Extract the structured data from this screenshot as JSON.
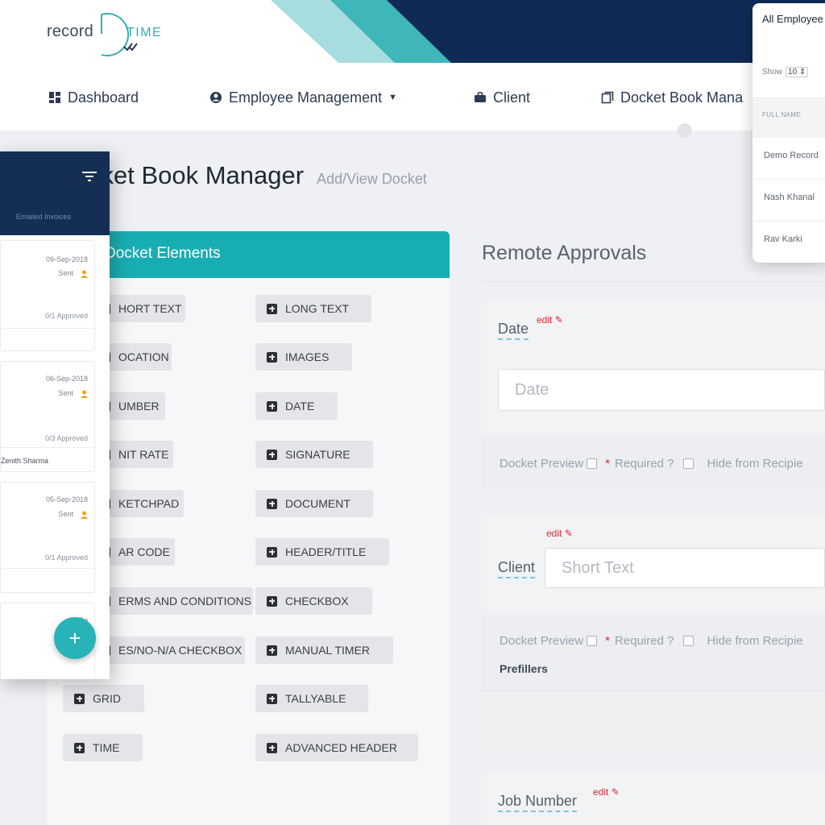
{
  "logo": {
    "word1": "record",
    "word2": "TIME"
  },
  "nav": {
    "items": [
      {
        "label": "Dashboard"
      },
      {
        "label": "Employee Management"
      },
      {
        "label": "Client"
      },
      {
        "label": "Docket Book Mana"
      }
    ]
  },
  "page": {
    "title": "cket Book Manager",
    "subtitle": "Add/View Docket"
  },
  "elements": {
    "header": "Docket Elements",
    "left": [
      "HORT TEXT",
      "OCATION",
      "UMBER",
      "NIT RATE",
      "KETCHPAD",
      "AR CODE",
      "ERMS AND CONDITIONS",
      "ES/NO-N/A CHECKBOX",
      "GRID",
      "TIME"
    ],
    "right": [
      "LONG TEXT",
      "IMAGES",
      "DATE",
      "SIGNATURE",
      "DOCUMENT",
      "HEADER/TITLE",
      "CHECKBOX",
      "MANUAL TIMER",
      "TALLYABLE",
      "ADVANCED HEADER"
    ]
  },
  "remote": {
    "title": "Remote Approvals",
    "edit": "edit",
    "date": {
      "label": "Date",
      "placeholder": "Date"
    },
    "options": {
      "preview": "Docket Preview",
      "required": "Required ?",
      "hide": "Hide from Recipie"
    },
    "client": {
      "label": "Client",
      "placeholder": "Short Text",
      "prefillers": "Prefillers"
    },
    "job": {
      "label": "Job Number"
    }
  },
  "mobile": {
    "tab": "Emailed Invoices",
    "cards": [
      {
        "date": "09-Sep-2018",
        "status": "Sent",
        "approved": "0/1 Approved",
        "name": ""
      },
      {
        "date": "06-Sep-2018",
        "status": "Sent",
        "approved": "0/3 Approved",
        "name": "Zenith Sharma"
      },
      {
        "date": "05-Sep-2018",
        "status": "Sent",
        "approved": "0/1 Approved",
        "name": ""
      },
      {
        "date": "05-Se",
        "status": "",
        "approved": "",
        "name": ""
      }
    ],
    "fab": "+"
  },
  "employees": {
    "title": "All Employee",
    "show_label": "Show",
    "show_value": "10",
    "column": "FULL NAME",
    "rows": [
      "Demo Record",
      "Nash Khanal",
      "Rav Karki"
    ]
  },
  "colors": {
    "teal": "#17aeb3",
    "navy": "#152e54",
    "red": "#e0262f"
  }
}
